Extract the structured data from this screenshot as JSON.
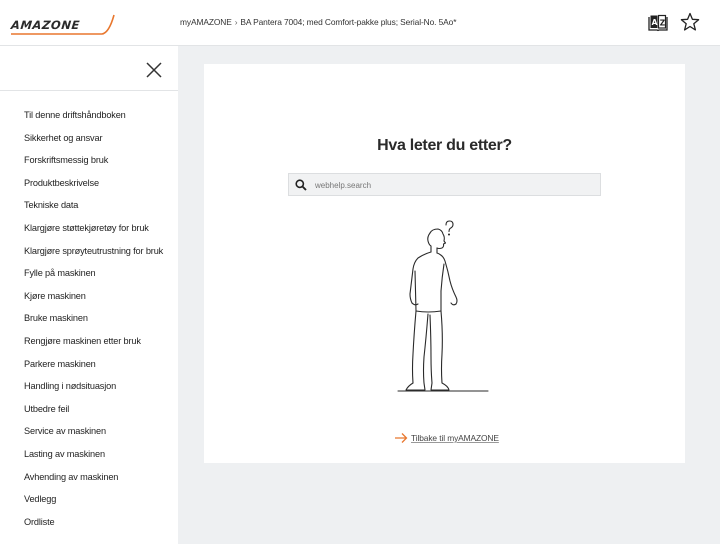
{
  "header": {
    "logo_text": "AMAZONE",
    "breadcrumb_root": "myAMAZONE",
    "breadcrumb_separator": "›",
    "breadcrumb_current": "BA Pantera 7004; med Comfort-pakke plus; Serial-No. 5Ao*",
    "icons": [
      "dictionary-icon",
      "star-icon"
    ]
  },
  "sidebar": {
    "close_icon": "close-icon",
    "items": [
      {
        "label": "Til denne driftshåndboken"
      },
      {
        "label": "Sikkerhet og ansvar"
      },
      {
        "label": "Forskriftsmessig bruk"
      },
      {
        "label": "Produktbeskrivelse"
      },
      {
        "label": "Tekniske data"
      },
      {
        "label": "Klargjøre støttekjøretøy for bruk"
      },
      {
        "label": "Klargjøre sprøyteutrustning for bruk"
      },
      {
        "label": "Fylle på maskinen"
      },
      {
        "label": "Kjøre maskinen"
      },
      {
        "label": "Bruke maskinen"
      },
      {
        "label": "Rengjøre maskinen etter bruk"
      },
      {
        "label": "Parkere maskinen"
      },
      {
        "label": "Handling i nødsituasjon"
      },
      {
        "label": "Utbedre feil"
      },
      {
        "label": "Service av maskinen"
      },
      {
        "label": "Lasting av maskinen"
      },
      {
        "label": "Avhending av maskinen"
      },
      {
        "label": "Vedlegg"
      },
      {
        "label": "Ordliste"
      }
    ]
  },
  "main": {
    "title": "Hva leter du etter?",
    "search": {
      "placeholder": "webhelp.search",
      "value": ""
    },
    "illustration": "thinking-person-question-mark",
    "back_link": "Tilbake til myAMAZONE"
  },
  "colors": {
    "accent": "#e8772e",
    "background": "#eef0f2",
    "card": "#ffffff",
    "text": "#222222"
  }
}
